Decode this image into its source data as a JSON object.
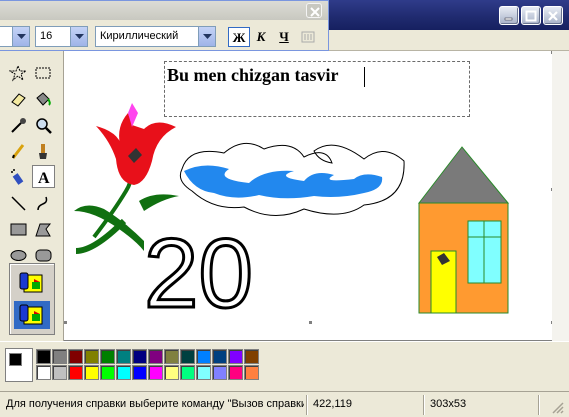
{
  "font_toolbar": {
    "font_size": "16",
    "script": "Кириллический",
    "bold_label": "Ж",
    "italic_label": "К",
    "underline_label": "Ч"
  },
  "canvas": {
    "text_content": "Bu men chizgan tasvir",
    "drawn_number": "20"
  },
  "palette": {
    "row1": [
      "#000000",
      "#808080",
      "#800000",
      "#808000",
      "#008000",
      "#008080",
      "#000080",
      "#800080",
      "#808040",
      "#004040",
      "#0080ff",
      "#004080",
      "#8000ff",
      "#804000"
    ],
    "row2": [
      "#ffffff",
      "#c0c0c0",
      "#ff0000",
      "#ffff00",
      "#00ff00",
      "#00ffff",
      "#0000ff",
      "#ff00ff",
      "#ffff80",
      "#00ff80",
      "#80ffff",
      "#8080ff",
      "#ff0080",
      "#ff8040"
    ],
    "primary": "#000000",
    "secondary": "#ffffff"
  },
  "statusbar": {
    "help_text": "Для получения справки выберите команду \"Вызов справки\"",
    "coords": "422,119",
    "size": "303x53"
  }
}
